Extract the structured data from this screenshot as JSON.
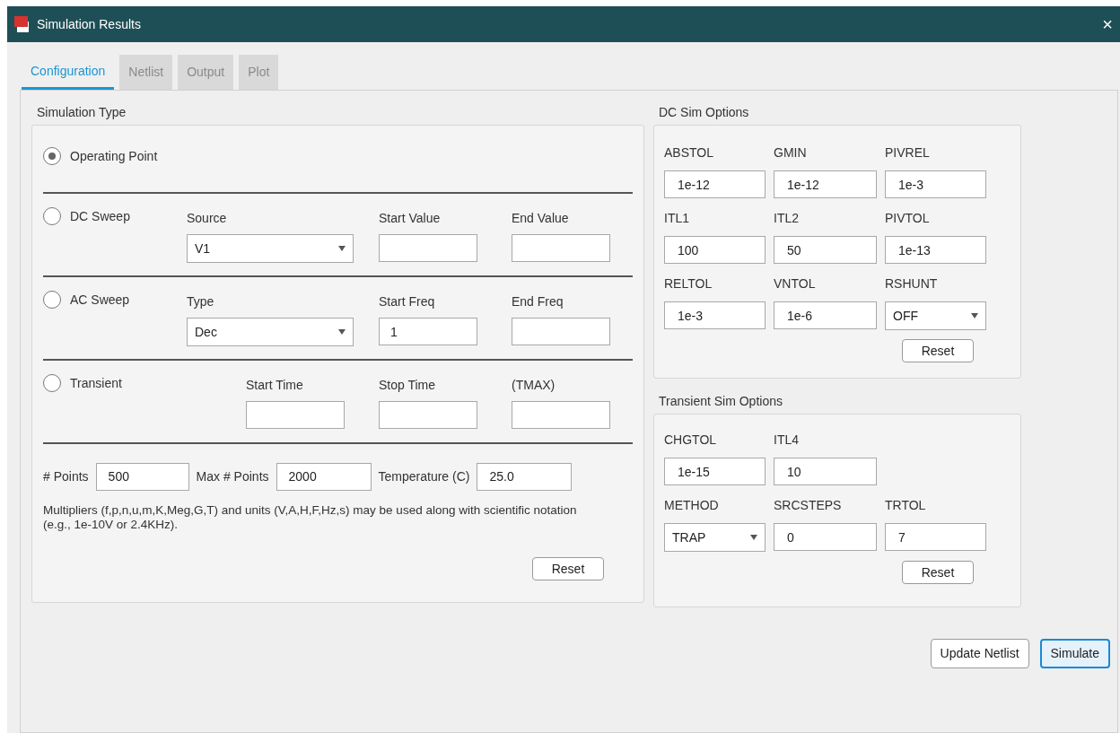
{
  "window": {
    "title": "Simulation Results",
    "close": "×"
  },
  "tabs": [
    {
      "label": "Configuration",
      "selected": true
    },
    {
      "label": "Netlist",
      "selected": false
    },
    {
      "label": "Output",
      "selected": false
    },
    {
      "label": "Plot",
      "selected": false
    }
  ],
  "simulation_type": {
    "title": "Simulation Type",
    "modes": [
      {
        "label": "Operating Point",
        "selected": true
      },
      {
        "label": "DC Sweep",
        "selected": false,
        "fields": [
          {
            "kind": "select",
            "label": "Source",
            "value": "V1"
          },
          {
            "kind": "text",
            "label": "Start Value"
          },
          {
            "kind": "text",
            "label": "End Value"
          }
        ]
      },
      {
        "label": "AC Sweep",
        "selected": false,
        "fields": [
          {
            "kind": "select",
            "label": "Type",
            "value": "Dec"
          },
          {
            "kind": "text",
            "label": "Start Freq",
            "value": "1"
          },
          {
            "kind": "text",
            "label": "End Freq"
          }
        ]
      },
      {
        "label": "Transient",
        "selected": false,
        "fields": [
          {
            "kind": "text",
            "label": "Start Time"
          },
          {
            "kind": "text",
            "label": "Stop Time"
          },
          {
            "kind": "text",
            "label": "(TMAX)"
          }
        ]
      }
    ],
    "settings": [
      {
        "label": "# Points",
        "value": "500"
      },
      {
        "label": "Max # Points",
        "value": "2000"
      },
      {
        "label": "Temperature (C)",
        "value": "25.0"
      }
    ],
    "note": "Multipliers (f,p,n,u,m,K,Meg,G,T) and units (V,A,H,F,Hz,s) may be used along with scientific notation (e.g., 1e-10V or 2.4KHz).",
    "reset": "Reset"
  },
  "dc_options": {
    "title": "DC Sim Options",
    "fields": [
      {
        "kind": "text",
        "label": "ABSTOL",
        "value": "1e-12"
      },
      {
        "kind": "text",
        "label": "GMIN",
        "value": "1e-12"
      },
      {
        "kind": "text",
        "label": "PIVREL",
        "value": "1e-3"
      },
      {
        "kind": "text",
        "label": "ITL1",
        "value": "100"
      },
      {
        "kind": "text",
        "label": "ITL2",
        "value": "50"
      },
      {
        "kind": "text",
        "label": "PIVTOL",
        "value": "1e-13"
      },
      {
        "kind": "text",
        "label": "RELTOL",
        "value": "1e-3"
      },
      {
        "kind": "text",
        "label": "VNTOL",
        "value": "1e-6"
      },
      {
        "kind": "select",
        "label": "RSHUNT",
        "value": "OFF"
      }
    ],
    "reset": "Reset"
  },
  "transient_options": {
    "title": "Transient Sim Options",
    "fields": [
      {
        "kind": "text",
        "label": "CHGTOL",
        "value": "1e-15"
      },
      {
        "kind": "text",
        "label": "ITL4",
        "value": "10"
      },
      {
        "kind": "empty"
      },
      {
        "kind": "select",
        "label": "METHOD",
        "value": "TRAP"
      },
      {
        "kind": "text",
        "label": "SRCSTEPS",
        "value": "0"
      },
      {
        "kind": "text",
        "label": "TRTOL",
        "value": "7"
      }
    ],
    "reset": "Reset"
  },
  "buttons": [
    {
      "label": "Update Netlist",
      "focused": false
    },
    {
      "label": "Simulate",
      "focused": true
    }
  ]
}
